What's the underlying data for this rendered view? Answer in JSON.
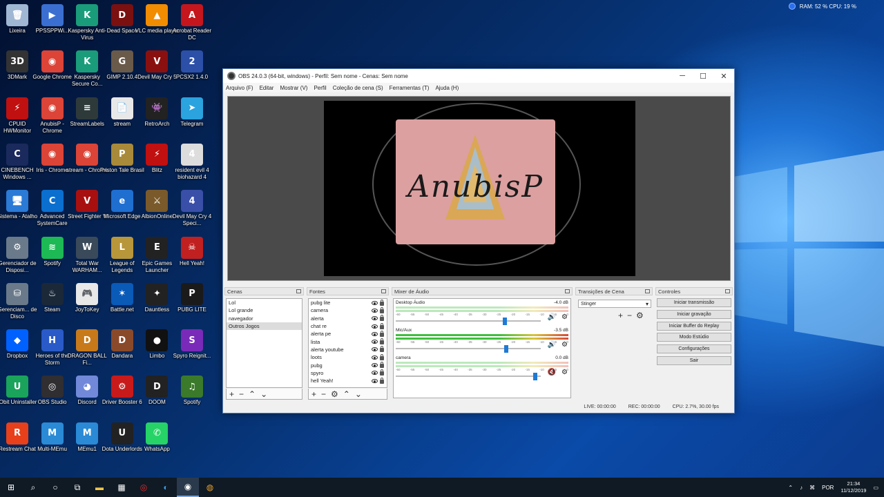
{
  "desktop": {
    "system_monitor": "RAM: 52 %  CPU: 19 %",
    "icons": [
      {
        "label": "Lixeira",
        "icon": "recycle-bin-icon",
        "color": "#9fb7d2",
        "glyph": "🗑"
      },
      {
        "label": "PPSSPPWi...",
        "icon": "ppsspp-icon",
        "color": "#3a6fd1",
        "glyph": "▶"
      },
      {
        "label": "Kaspersky Anti-Virus",
        "icon": "kaspersky-icon",
        "color": "#1a9c7a",
        "glyph": "K"
      },
      {
        "label": "Dead Space",
        "icon": "dead-space-icon",
        "color": "#7a1010",
        "glyph": "D"
      },
      {
        "label": "VLC media player",
        "icon": "vlc-icon",
        "color": "#f28c00",
        "glyph": "▲"
      },
      {
        "label": "Acrobat Reader DC",
        "icon": "acrobat-icon",
        "color": "#c4161c",
        "glyph": "A"
      },
      {
        "label": "3DMark",
        "icon": "3dmark-icon",
        "color": "#333",
        "glyph": "3D"
      },
      {
        "label": "Google Chrome",
        "icon": "chrome-icon",
        "color": "#db4437",
        "glyph": "◉"
      },
      {
        "label": "Kaspersky Secure Co...",
        "icon": "kaspersky-secure-icon",
        "color": "#1a9c7a",
        "glyph": "K"
      },
      {
        "label": "GIMP 2.10.4",
        "icon": "gimp-icon",
        "color": "#6a5a4a",
        "glyph": "G"
      },
      {
        "label": "Devil May Cry 5",
        "icon": "dmc5-icon",
        "color": "#8a1010",
        "glyph": "V"
      },
      {
        "label": "PCSX2 1.4.0",
        "icon": "pcsx2-icon",
        "color": "#2c4fa8",
        "glyph": "2"
      },
      {
        "label": "CPUID HWMonitor",
        "icon": "hwmonitor-icon",
        "color": "#c01010",
        "glyph": "⚡"
      },
      {
        "label": "AnubisP - Chrome",
        "icon": "chrome-icon",
        "color": "#db4437",
        "glyph": "◉"
      },
      {
        "label": "StreamLabels",
        "icon": "streamlabels-icon",
        "color": "#2e3a3a",
        "glyph": "≡"
      },
      {
        "label": "stream",
        "icon": "text-file-icon",
        "color": "#e8e8e8",
        "glyph": "📄"
      },
      {
        "label": "RetroArch",
        "icon": "retroarch-icon",
        "color": "#222",
        "glyph": "👾"
      },
      {
        "label": "Telegram",
        "icon": "telegram-icon",
        "color": "#2aa3df",
        "glyph": "➤"
      },
      {
        "label": "CINEBENCH Windows ...",
        "icon": "cinebench-icon",
        "color": "#1b2a5c",
        "glyph": "C"
      },
      {
        "label": "Iris - Chrome",
        "icon": "chrome-icon",
        "color": "#db4437",
        "glyph": "◉"
      },
      {
        "label": "stream - Chrome",
        "icon": "chrome-icon",
        "color": "#db4437",
        "glyph": "◉"
      },
      {
        "label": "Priston Tale Brasil",
        "icon": "priston-tale-icon",
        "color": "#a88a3a",
        "glyph": "P"
      },
      {
        "label": "Blitz",
        "icon": "blitz-icon",
        "color": "#c01010",
        "glyph": "⚡"
      },
      {
        "label": "resident evil 4 biohazard 4",
        "icon": "re4-icon",
        "color": "#ddd",
        "glyph": "4"
      },
      {
        "label": "Sistema - Atalho",
        "icon": "system-icon",
        "color": "#2a7ad6",
        "glyph": "🖥"
      },
      {
        "label": "Advanced SystemCare",
        "icon": "asc-icon",
        "color": "#0a6fcf",
        "glyph": "C"
      },
      {
        "label": "Street Fighter V",
        "icon": "sfv-icon",
        "color": "#a81010",
        "glyph": "V"
      },
      {
        "label": "Microsoft Edge",
        "icon": "edge-icon",
        "color": "#1f6fd1",
        "glyph": "e"
      },
      {
        "label": "AlbionOnline",
        "icon": "albion-icon",
        "color": "#7a5a2a",
        "glyph": "⚔"
      },
      {
        "label": "Devil May Cry 4 Speci...",
        "icon": "dmc4-icon",
        "color": "#3a4fa8",
        "glyph": "4"
      },
      {
        "label": "Gerenciador de Disposi...",
        "icon": "device-manager-icon",
        "color": "#6a7a8a",
        "glyph": "⚙"
      },
      {
        "label": "Spotify",
        "icon": "spotify-icon",
        "color": "#1db954",
        "glyph": "≋"
      },
      {
        "label": "Total War WARHAM...",
        "icon": "warhammer-icon",
        "color": "#3a4a5a",
        "glyph": "W"
      },
      {
        "label": "League of Legends",
        "icon": "lol-icon",
        "color": "#b8963a",
        "glyph": "L"
      },
      {
        "label": "Epic Games Launcher",
        "icon": "epic-icon",
        "color": "#222",
        "glyph": "E"
      },
      {
        "label": "Hell Yeah!",
        "icon": "hell-yeah-icon",
        "color": "#c02020",
        "glyph": "☠"
      },
      {
        "label": "Gerenciam... de Disco",
        "icon": "disk-management-icon",
        "color": "#6a7a8a",
        "glyph": "⛁"
      },
      {
        "label": "Steam",
        "icon": "steam-icon",
        "color": "#1b2838",
        "glyph": "♨"
      },
      {
        "label": "JoyToKey",
        "icon": "joytokey-icon",
        "color": "#e8e8e8",
        "glyph": "🎮"
      },
      {
        "label": "Battle.net",
        "icon": "battlenet-icon",
        "color": "#0a5ab8",
        "glyph": "✶"
      },
      {
        "label": "Dauntless",
        "icon": "dauntless-icon",
        "color": "#222",
        "glyph": "✦"
      },
      {
        "label": "PUBG LITE",
        "icon": "pubg-icon",
        "color": "#1a1a1a",
        "glyph": "P"
      },
      {
        "label": "Dropbox",
        "icon": "dropbox-icon",
        "color": "#0061fe",
        "glyph": "◆"
      },
      {
        "label": "Heroes of the Storm",
        "icon": "hots-icon",
        "color": "#2a5ac8",
        "glyph": "H"
      },
      {
        "label": "DRAGON BALL Fi...",
        "icon": "dbfz-icon",
        "color": "#c87a1a",
        "glyph": "D"
      },
      {
        "label": "Dandara",
        "icon": "dandara-icon",
        "color": "#8a4a2a",
        "glyph": "D"
      },
      {
        "label": "Limbo",
        "icon": "limbo-icon",
        "color": "#111",
        "glyph": "●"
      },
      {
        "label": "Spyro Reignit...",
        "icon": "spyro-icon",
        "color": "#7a2ab8",
        "glyph": "S"
      },
      {
        "label": "IObit Uninstaller",
        "icon": "iobit-icon",
        "color": "#1aa35a",
        "glyph": "U"
      },
      {
        "label": "OBS Studio",
        "icon": "obs-icon",
        "color": "#302e31",
        "glyph": "◎"
      },
      {
        "label": "Discord",
        "icon": "discord-icon",
        "color": "#7289da",
        "glyph": "◕"
      },
      {
        "label": "Driver Booster 6",
        "icon": "driver-booster-icon",
        "color": "#c81a1a",
        "glyph": "⚙"
      },
      {
        "label": "DOOM",
        "icon": "doom-icon",
        "color": "#222",
        "glyph": "D"
      },
      {
        "label": "Spotify",
        "icon": "spotify-alt-icon",
        "color": "#3a7a2a",
        "glyph": "♫"
      },
      {
        "label": "Restream Chat",
        "icon": "restream-icon",
        "color": "#e8401a",
        "glyph": "R"
      },
      {
        "label": "Multi-MEmu",
        "icon": "memu-multi-icon",
        "color": "#2a8ad6",
        "glyph": "M"
      },
      {
        "label": "MEmu1",
        "icon": "memu-icon",
        "color": "#2a8ad6",
        "glyph": "M"
      },
      {
        "label": "Dota Underlords",
        "icon": "underlords-icon",
        "color": "#222",
        "glyph": "U"
      },
      {
        "label": "WhatsApp",
        "icon": "whatsapp-icon",
        "color": "#25d366",
        "glyph": "✆"
      }
    ]
  },
  "obs": {
    "title": "OBS 24.0.3 (64-bit, windows) - Perfil: Sem nome - Cenas: Sem nome",
    "menu": [
      "Arquivo (F)",
      "Editar",
      "Mostrar (V)",
      "Perfil",
      "Coleção de cena (S)",
      "Ferramentas (T)",
      "Ajuda (H)"
    ],
    "preview_logo_text": "AnubisP",
    "docks": {
      "scenes": {
        "title": "Cenas",
        "items": [
          "Lol",
          "Lol grande",
          "navegador",
          "Outros Jogos"
        ],
        "selected": 3
      },
      "sources": {
        "title": "Fontes",
        "items": [
          "pubg lite",
          "camera",
          "alerta",
          "chat re",
          "alerta pe",
          "lista",
          "alerta youtube",
          "loots",
          "pubg",
          "spyro",
          "hell Yeah!"
        ]
      },
      "mixer": {
        "title": "Mixer de Áudio",
        "channels": [
          {
            "name": "Desktop Áudio",
            "db": "-4.0 dB",
            "level": 0.75,
            "active": false,
            "muted": false
          },
          {
            "name": "Mic/Aux",
            "db": "-3.5 dB",
            "level": 0.76,
            "active": true,
            "muted": false
          },
          {
            "name": "camera",
            "db": "0.0 dB",
            "level": 0.96,
            "active": false,
            "muted": true
          }
        ],
        "scale": [
          "-60",
          "-55",
          "-50",
          "-45",
          "-40",
          "-35",
          "-30",
          "-25",
          "-20",
          "-15",
          "-10",
          "-5",
          "0"
        ]
      },
      "transitions": {
        "title": "Transições de Cena",
        "selected": "Stinger"
      },
      "controls": {
        "title": "Controles",
        "buttons": [
          "Iniciar transmissão",
          "Iniciar gravação",
          "Iniciar Buffer do Replay",
          "Modo Estúdio",
          "Configurações",
          "Sair"
        ]
      }
    },
    "status": {
      "live": "LIVE: 00:00:00",
      "rec": "REC: 00:00:00",
      "cpu": "CPU: 2.7%, 30.00 fps"
    }
  },
  "taskbar": {
    "language": "POR",
    "time": "21:34",
    "date": "11/12/2019"
  }
}
